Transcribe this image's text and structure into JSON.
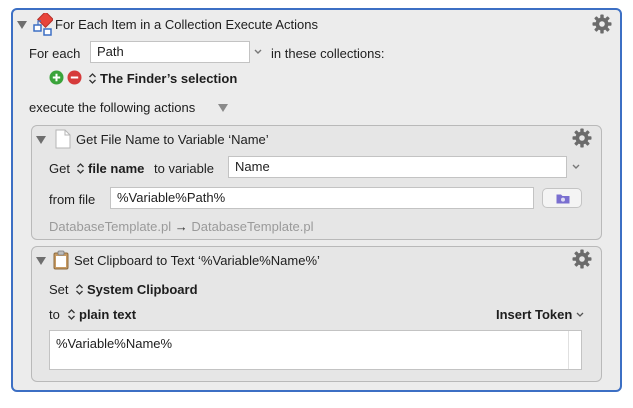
{
  "main_action": {
    "title": "For Each Item in a Collection Execute Actions",
    "for_each_label": "For each",
    "variable_value": "Path",
    "in_collections_label": "in these collections:",
    "collection": "The Finder’s selection",
    "execute_label": "execute the following actions"
  },
  "action1": {
    "title": "Get File Name to Variable ‘Name’",
    "get_label": "Get",
    "attribute": "file name",
    "to_variable_label": "to variable",
    "variable_value": "Name",
    "from_file_label": "from file",
    "file_value": "%Variable%Path%",
    "preview_source": "DatabaseTemplate.pl",
    "preview_arrow": "→",
    "preview_result": "DatabaseTemplate.pl"
  },
  "action2": {
    "title": "Set Clipboard to Text ‘%Variable%Name%’",
    "set_label": "Set",
    "clipboard": "System Clipboard",
    "to_label": "to",
    "format": "plain text",
    "insert_token_label": "Insert Token",
    "text_value": "%Variable%Name%"
  },
  "colors": {
    "accent": "#3c6fc4",
    "add_green": "#3aa33a",
    "remove_red": "#d63b3b",
    "folder_purple": "#7a6fd0"
  },
  "icons": {
    "gear": "gear-icon",
    "add": "plus-circle-icon",
    "remove": "minus-circle-icon",
    "folder": "folder-icon",
    "document": "document-icon",
    "clipboard": "clipboard-icon",
    "action": "for-each-action-icon"
  }
}
